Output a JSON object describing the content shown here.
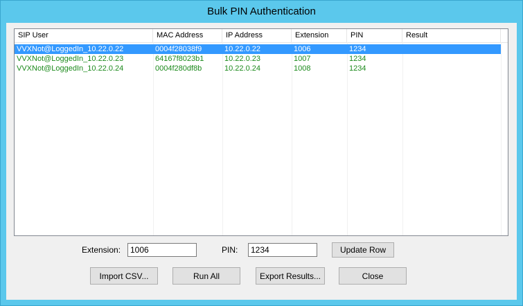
{
  "window": {
    "title": "Bulk PIN Authentication"
  },
  "list": {
    "columns": [
      "SIP User",
      "MAC Address",
      "IP Address",
      "Extension",
      "PIN",
      "Result"
    ],
    "rows": [
      {
        "sip_user": "VVXNot@LoggedIn_10.22.0.22",
        "mac": "0004f28038f9",
        "ip": "10.22.0.22",
        "extension": "1006",
        "pin": "1234",
        "result": ""
      },
      {
        "sip_user": "VVXNot@LoggedIn_10.22.0.23",
        "mac": "64167f8023b1",
        "ip": "10.22.0.23",
        "extension": "1007",
        "pin": "1234",
        "result": ""
      },
      {
        "sip_user": "VVXNot@LoggedIn_10.22.0.24",
        "mac": "0004f280df8b",
        "ip": "10.22.0.24",
        "extension": "1008",
        "pin": "1234",
        "result": ""
      }
    ],
    "selected_row": 0,
    "colors": {
      "selected_bg": "#3399ff",
      "row_text": "#1c8a1c"
    }
  },
  "form": {
    "extension_label": "Extension:",
    "extension_value": "1006",
    "pin_label": "PIN:",
    "pin_value": "1234",
    "update_row_label": "Update Row"
  },
  "buttons": {
    "import_csv": "Import CSV...",
    "run_all": "Run All",
    "export_results": "Export Results...",
    "close": "Close"
  }
}
